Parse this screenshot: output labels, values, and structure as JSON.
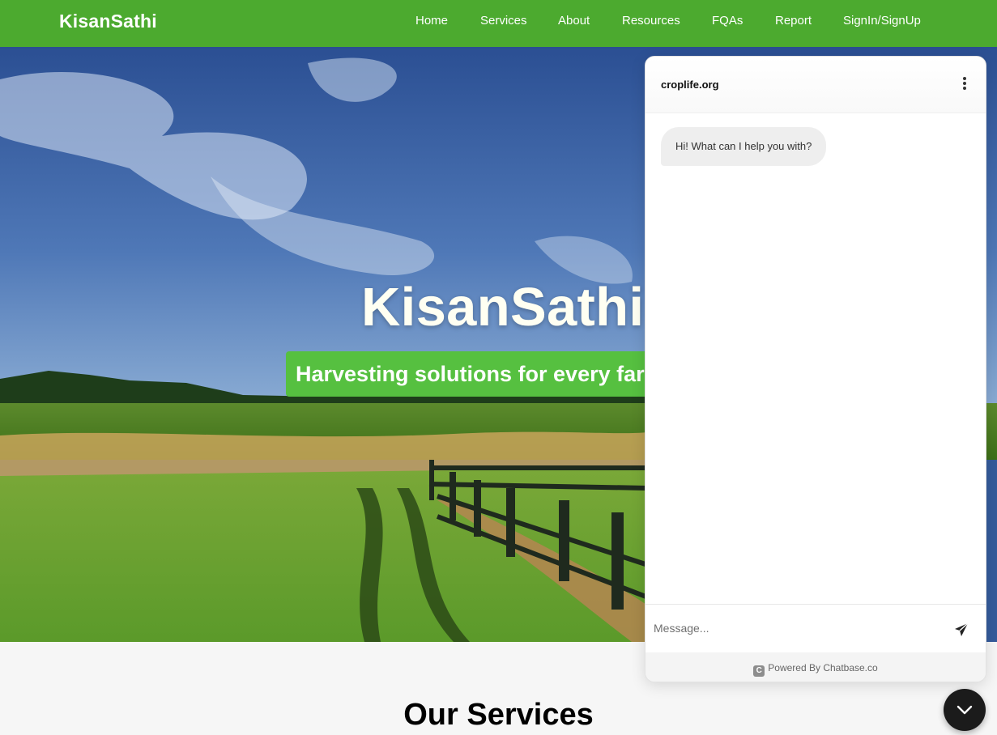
{
  "navbar": {
    "brand": "KisanSathi",
    "links": [
      "Home",
      "Services",
      "About",
      "Resources",
      "FQAs",
      "Report",
      "SignIn/SignUp"
    ]
  },
  "hero": {
    "title": "KisanSathi",
    "tagline": "Harvesting solutions for every farmer"
  },
  "services": {
    "title": "Our Services"
  },
  "chat": {
    "site": "croplife.org",
    "greeting": "Hi! What can I help you with?",
    "input_placeholder": "Message...",
    "footer": "Powered By Chatbase.co",
    "footer_logo_letter": "C",
    "menu_icon": "kebab-menu-icon",
    "send_icon": "send-icon",
    "toggle_icon": "chevron-down-icon"
  },
  "colors": {
    "nav_green": "#4caa2f",
    "tag_green": "#56c040",
    "chat_toggle": "#1b1b1b"
  }
}
